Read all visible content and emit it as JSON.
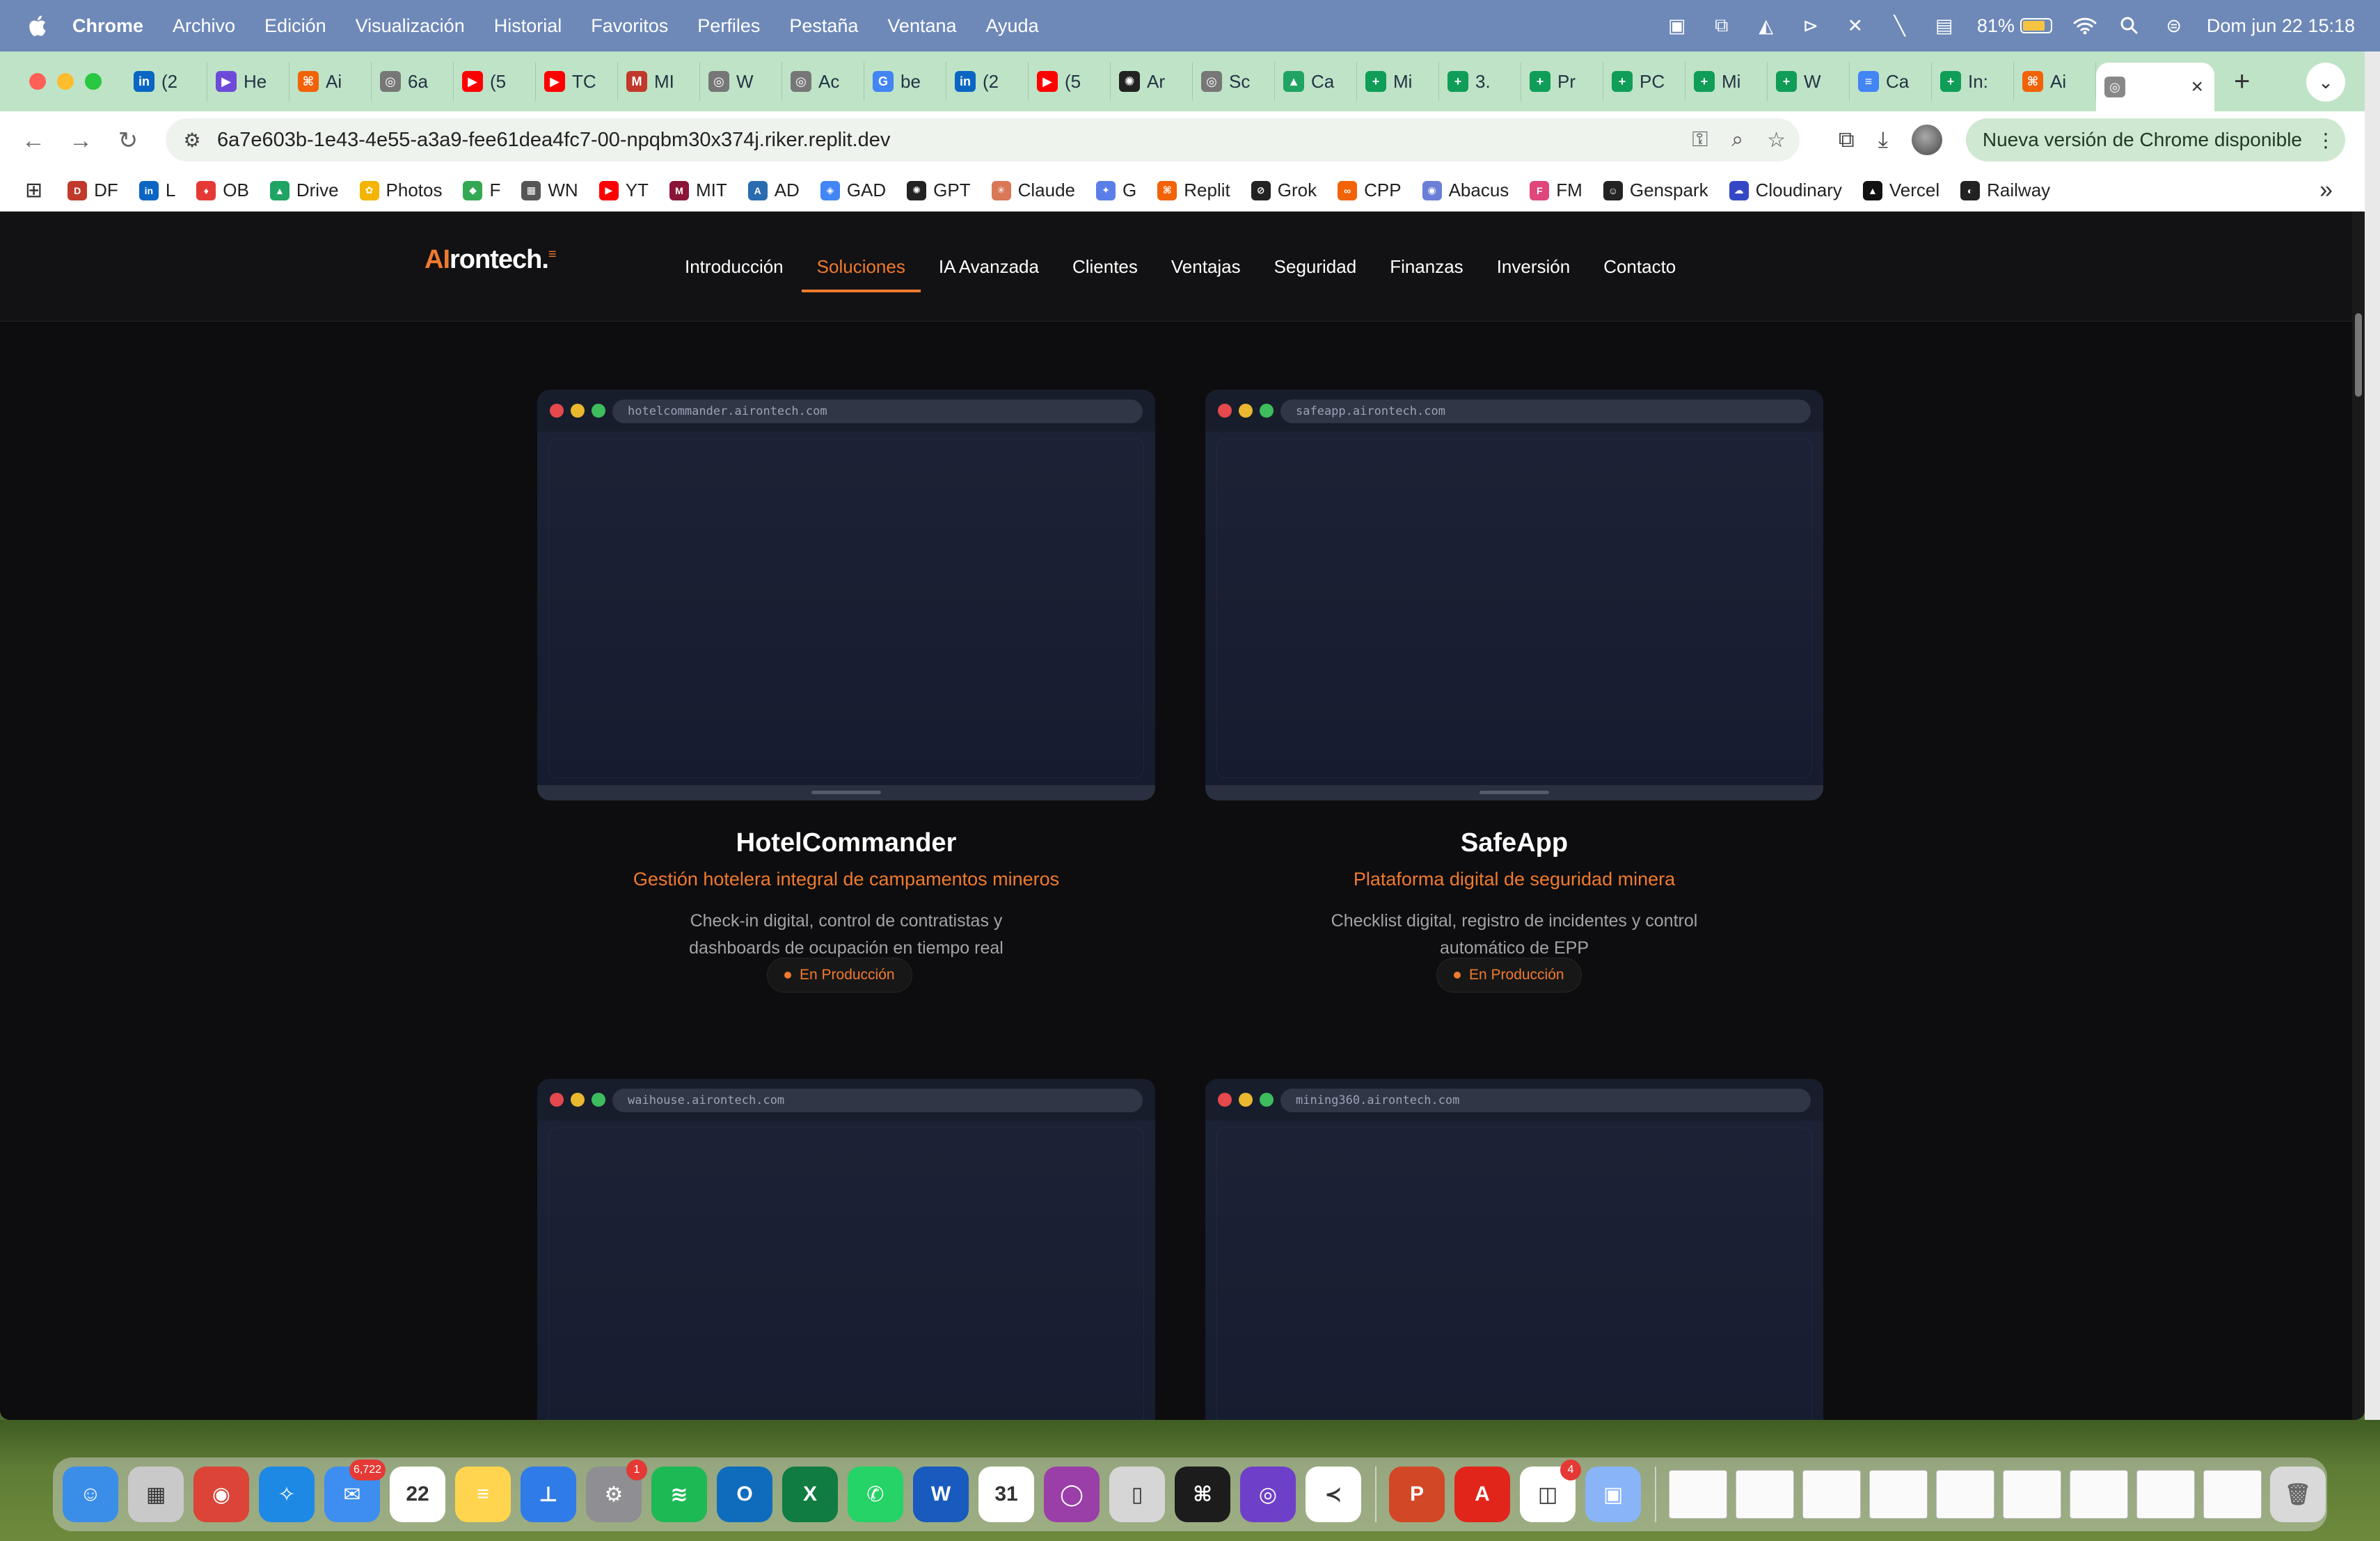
{
  "menubar": {
    "app_name": "Chrome",
    "items": [
      "Archivo",
      "Edición",
      "Visualización",
      "Historial",
      "Favoritos",
      "Perfiles",
      "Pestaña",
      "Ventana",
      "Ayuda"
    ],
    "battery_percent": "81%",
    "clock": "Dom jun 22  15:18",
    "status_icons": [
      "outlook-icon",
      "cast-icon",
      "drive-icon",
      "play-icon",
      "mute-icon",
      "pen-icon",
      "keyboard-icon",
      "wifi-icon",
      "search-icon",
      "control-center-icon"
    ]
  },
  "tabs": [
    {
      "label": "(2",
      "icon": "linkedin-icon",
      "color": "#0a66c2",
      "glyph": "in"
    },
    {
      "label": "He",
      "icon": "play-circle-icon",
      "color": "#6d4bd8",
      "glyph": "▶"
    },
    {
      "label": "Ai",
      "icon": "replit-icon",
      "color": "#f26207",
      "glyph": "⌘"
    },
    {
      "label": "6a",
      "icon": "globe-icon",
      "color": "#777777",
      "glyph": "◎"
    },
    {
      "label": "(5",
      "icon": "youtube-icon",
      "color": "#ff0000",
      "glyph": "▶"
    },
    {
      "label": "TC",
      "icon": "youtube-icon",
      "color": "#ff0000",
      "glyph": "▶"
    },
    {
      "label": "MI",
      "icon": "mit-icon",
      "color": "#c0392b",
      "glyph": "M"
    },
    {
      "label": "W",
      "icon": "globe-icon",
      "color": "#777777",
      "glyph": "◎"
    },
    {
      "label": "Ac",
      "icon": "globe-icon",
      "color": "#777777",
      "glyph": "◎"
    },
    {
      "label": "be",
      "icon": "google-icon",
      "color": "#4285f4",
      "glyph": "G"
    },
    {
      "label": "(2",
      "icon": "linkedin-icon",
      "color": "#0a66c2",
      "glyph": "in"
    },
    {
      "label": "(5",
      "icon": "youtube-icon",
      "color": "#ff0000",
      "glyph": "▶"
    },
    {
      "label": "Ar",
      "icon": "openai-icon",
      "color": "#222222",
      "glyph": "✺"
    },
    {
      "label": "Sc",
      "icon": "globe-icon",
      "color": "#777777",
      "glyph": "◎"
    },
    {
      "label": "Ca",
      "icon": "drive-icon",
      "color": "#1fa463",
      "glyph": "▲"
    },
    {
      "label": "Mi",
      "icon": "sheets-icon",
      "color": "#0f9d58",
      "glyph": "+"
    },
    {
      "label": "3.",
      "icon": "sheets-icon",
      "color": "#0f9d58",
      "glyph": "+"
    },
    {
      "label": "Pr",
      "icon": "sheets-icon",
      "color": "#0f9d58",
      "glyph": "+"
    },
    {
      "label": "PC",
      "icon": "sheets-icon",
      "color": "#0f9d58",
      "glyph": "+"
    },
    {
      "label": "Mi",
      "icon": "sheets-icon",
      "color": "#0f9d58",
      "glyph": "+"
    },
    {
      "label": "W",
      "icon": "sheets-icon",
      "color": "#0f9d58",
      "glyph": "+"
    },
    {
      "label": "Ca",
      "icon": "docs-icon",
      "color": "#4285f4",
      "glyph": "≡"
    },
    {
      "label": "In:",
      "icon": "sheets-icon",
      "color": "#0f9d58",
      "glyph": "+"
    },
    {
      "label": "Ai",
      "icon": "replit-icon",
      "color": "#f26207",
      "glyph": "⌘"
    }
  ],
  "active_tab": {
    "icon": "globe-icon",
    "close": "×"
  },
  "new_tab": "+",
  "tab_menu": "⌄",
  "toolbar": {
    "url": "6a7e603b-1e43-4e55-a3a9-fee61dea4fc7-00-npqbm30x374j.riker.replit.dev",
    "update_label": "Nueva versión de Chrome disponible"
  },
  "bookmarks": [
    {
      "label": "DF",
      "color": "#c0392b",
      "glyph": "D"
    },
    {
      "label": "L",
      "color": "#0a66c2",
      "glyph": "in"
    },
    {
      "label": "OB",
      "color": "#e53935",
      "glyph": "♦"
    },
    {
      "label": "Drive",
      "color": "#1fa463",
      "glyph": "▲"
    },
    {
      "label": "Photos",
      "color": "#f4b400",
      "glyph": "✿"
    },
    {
      "label": "F",
      "color": "#34a853",
      "glyph": "◆"
    },
    {
      "label": "WN",
      "color": "#555555",
      "glyph": "▦"
    },
    {
      "label": "YT",
      "color": "#ff0000",
      "glyph": "▶"
    },
    {
      "label": "MIT",
      "color": "#8a1538",
      "glyph": "M"
    },
    {
      "label": "AD",
      "color": "#2b6cb0",
      "glyph": "A"
    },
    {
      "label": "GAD",
      "color": "#4285f4",
      "glyph": "◈"
    },
    {
      "label": "GPT",
      "color": "#222222",
      "glyph": "✺"
    },
    {
      "label": "Claude",
      "color": "#d97757",
      "glyph": "✳"
    },
    {
      "label": "G",
      "color": "#5b7fe8",
      "glyph": "✦"
    },
    {
      "label": "Replit",
      "color": "#f26207",
      "glyph": "⌘"
    },
    {
      "label": "Grok",
      "color": "#222222",
      "glyph": "⊘"
    },
    {
      "label": "CPP",
      "color": "#f26207",
      "glyph": "∞"
    },
    {
      "label": "Abacus",
      "color": "#6b7fd7",
      "glyph": "◉"
    },
    {
      "label": "FM",
      "color": "#e0457b",
      "glyph": "F"
    },
    {
      "label": "Genspark",
      "color": "#222222",
      "glyph": "☺"
    },
    {
      "label": "Cloudinary",
      "color": "#3448c5",
      "glyph": "☁"
    },
    {
      "label": "Vercel",
      "color": "#111111",
      "glyph": "▲"
    },
    {
      "label": "Railway",
      "color": "#222222",
      "glyph": "◐"
    }
  ],
  "site": {
    "logo": {
      "ai": "AI",
      "rest": "rontech.",
      "sup": "≡"
    },
    "nav": [
      "Introducción",
      "Soluciones",
      "IA Avanzada",
      "Clientes",
      "Ventajas",
      "Seguridad",
      "Finanzas",
      "Inversión",
      "Contacto"
    ],
    "active_nav": "Soluciones",
    "accent": "#f07a2e",
    "cards": [
      {
        "url": "hotelcommander.airontech.com",
        "title": "HotelCommander",
        "subtitle": "Gestión hotelera integral de campamentos mineros",
        "desc_l1": "Check-in digital, control de contratistas y",
        "desc_l2": "dashboards de ocupación en tiempo real",
        "status": "En Producción"
      },
      {
        "url": "safeapp.airontech.com",
        "title": "SafeApp",
        "subtitle": "Plataforma digital de seguridad minera",
        "desc_l1": "Checklist digital, registro de incidentes y control",
        "desc_l2": "automático de EPP",
        "status": "En Producción"
      },
      {
        "url": "waihouse.airontech.com"
      },
      {
        "url": "mining360.airontech.com"
      }
    ]
  },
  "dock": {
    "apps": [
      {
        "name": "finder-icon",
        "color": "#3b8ee8",
        "glyph": "☺"
      },
      {
        "name": "launchpad-icon",
        "color": "#c9c9c9",
        "glyph": "▦"
      },
      {
        "name": "chrome-icon",
        "color": "#db4437",
        "glyph": "◉"
      },
      {
        "name": "safari-icon",
        "color": "#1e88e5",
        "glyph": "✧"
      },
      {
        "name": "mail-icon",
        "color": "#3d8ef0",
        "glyph": "✉",
        "badge": "6,722"
      },
      {
        "name": "calendar-icon",
        "color": "#ffffff",
        "glyph": "22"
      },
      {
        "name": "notes-icon",
        "color": "#ffd54f",
        "glyph": "≡"
      },
      {
        "name": "keynote-icon",
        "color": "#2f7be8",
        "glyph": "⊥"
      },
      {
        "name": "settings-icon",
        "color": "#8e8e93",
        "glyph": "⚙",
        "badge": "1"
      },
      {
        "name": "spotify-icon",
        "color": "#1db954",
        "glyph": "≋"
      },
      {
        "name": "outlook-icon",
        "color": "#0f6cbd",
        "glyph": "O"
      },
      {
        "name": "excel-icon",
        "color": "#107c41",
        "glyph": "X"
      },
      {
        "name": "whatsapp-icon",
        "color": "#25d366",
        "glyph": "✆"
      },
      {
        "name": "word-icon",
        "color": "#185abd",
        "glyph": "W"
      },
      {
        "name": "fantastical-icon",
        "color": "#ffffff",
        "glyph": "31"
      },
      {
        "name": "screen-recorder-icon",
        "color": "#9b3fa8",
        "glyph": "◯"
      },
      {
        "name": "iphone-mirroring-icon",
        "color": "#d6d6d6",
        "glyph": "▯"
      },
      {
        "name": "replit-icon",
        "color": "#1c1c1c",
        "glyph": "⌘"
      },
      {
        "name": "github-icon",
        "color": "#6e40c9",
        "glyph": "◎"
      },
      {
        "name": "vscode-icon",
        "color": "#ffffff",
        "glyph": "≺"
      }
    ],
    "apps2": [
      {
        "name": "presentation-icon",
        "color": "#d24726",
        "glyph": "P"
      },
      {
        "name": "acrobat-icon",
        "color": "#e1251b",
        "glyph": "A"
      },
      {
        "name": "office-icon",
        "color": "#ffffff",
        "glyph": "◫",
        "badge": "4"
      },
      {
        "name": "preview-icon",
        "color": "#8ab4f8",
        "glyph": "▣"
      }
    ],
    "thumbs": 9,
    "trash": "trash-icon"
  }
}
